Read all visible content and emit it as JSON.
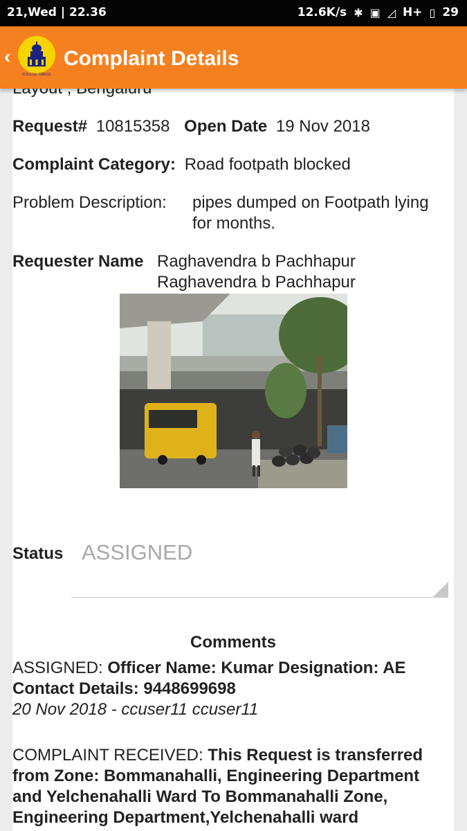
{
  "status_bar": {
    "left": "21,Wed | 22.36",
    "speed": "12.6K/s",
    "network": "H+",
    "battery": "29",
    "bluetooth_icon": "bluetooth-icon",
    "vibrate_icon": "vibrate-icon",
    "signal_icon": "signal-icon",
    "battery_icon": "battery-icon"
  },
  "app_bar": {
    "title": "Complaint Details",
    "logo_caption": "ಬಿಬಿಎಂಪಿ ಸಹಾಯ",
    "color": "#f58020"
  },
  "details": {
    "address_cut": "Layout , Bengaluru",
    "request_label": "Request#",
    "request_value": "10815358",
    "open_date_label": "Open Date",
    "open_date_value": "19 Nov 2018",
    "category_label": "Complaint Category:",
    "category_value": "Road footpath blocked",
    "problem_label": "Problem Description:",
    "problem_line1": "pipes dumped on Footpath lying",
    "problem_line2": "for months.",
    "requester_label": "Requester Name",
    "requester_line1": "Raghavendra b Pachhapur",
    "requester_line2": "Raghavendra b Pachhapur"
  },
  "status": {
    "label": "Status",
    "value": "ASSIGNED"
  },
  "comments": {
    "heading": "Comments",
    "items": [
      {
        "prefix": "ASSIGNED: ",
        "bold_line1": "Officer Name: Kumar Designation: AE",
        "bold_line2": "Contact Details: 9448699698",
        "meta": "20 Nov 2018 - ccuser11 ccuser11"
      },
      {
        "prefix": "COMPLAINT RECEIVED: ",
        "bold_line1": "This Request is transferred",
        "bold_line2": "from Zone: Bommanahalli, Engineering Department",
        "bold_line3": "and Yelchenahalli Ward To Bommanahalli Zone,",
        "bold_line4": "Engineering Department,Yelchenahalli ward"
      }
    ]
  }
}
